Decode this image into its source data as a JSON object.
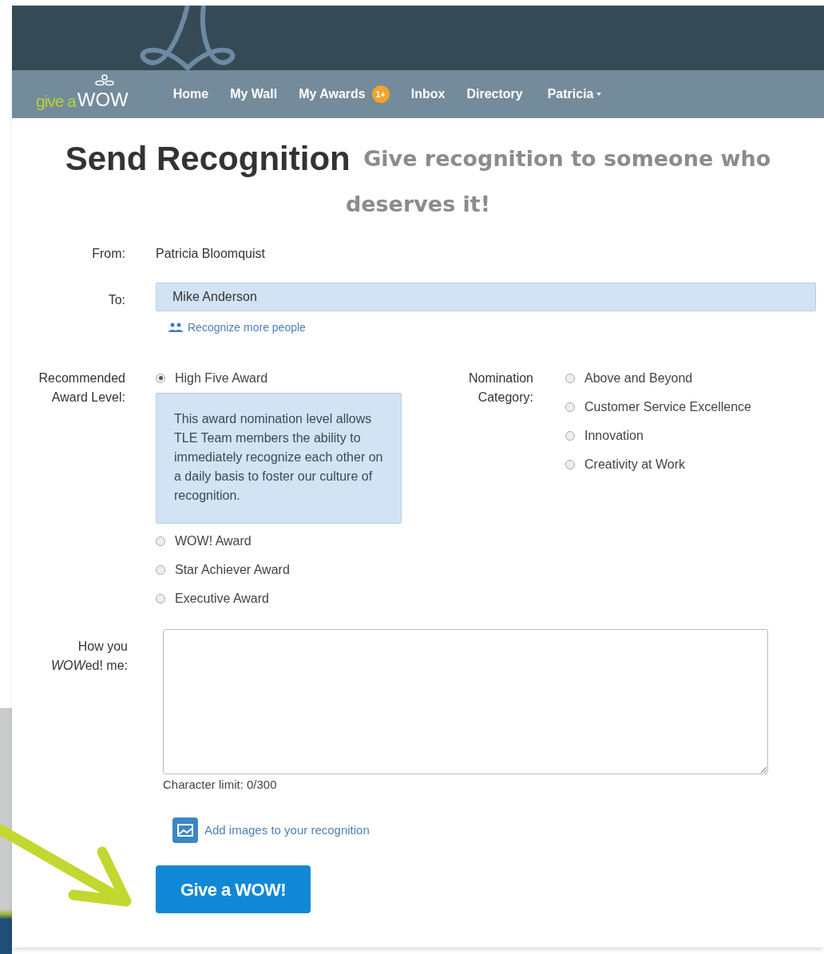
{
  "brand": {
    "first": "give a",
    "second": "WOW"
  },
  "nav": [
    {
      "label": "Home"
    },
    {
      "label": "My Wall"
    },
    {
      "label": "My Awards",
      "badge": "1+"
    },
    {
      "label": "Inbox"
    },
    {
      "label": "Directory"
    },
    {
      "label": "Patricia",
      "kind": "dropdown"
    }
  ],
  "heading": {
    "title": "Send Recognition",
    "subtitle": "Give recognition to someone who deserves it!"
  },
  "from": {
    "label": "From:",
    "value": "Patricia Bloomquist"
  },
  "to": {
    "label": "To:",
    "value": "Mike Anderson",
    "link": "Recognize more people"
  },
  "award_level": {
    "label": "Recommended Award Level:",
    "options": [
      {
        "label": "High Five Award",
        "selected": true,
        "description": "This award nomination level allows TLE Team members the ability to immediately recognize each other on a daily basis to foster our culture of recognition."
      },
      {
        "label": "WOW! Award",
        "selected": false
      },
      {
        "label": "Star Achiever Award",
        "selected": false
      },
      {
        "label": "Executive Award",
        "selected": false
      }
    ]
  },
  "nomination_category": {
    "label": "Nomination Category:",
    "options": [
      {
        "label": "Above and Beyond",
        "selected": false
      },
      {
        "label": "Customer Service Excellence",
        "selected": false
      },
      {
        "label": "Innovation",
        "selected": false
      },
      {
        "label": "Creativity at Work",
        "selected": false
      }
    ]
  },
  "message": {
    "label_parts": [
      {
        "text": "How you ",
        "italic": false
      },
      {
        "text": "WOW",
        "italic": true
      },
      {
        "text": "ed! me:",
        "italic": false
      }
    ],
    "counter": "Character limit: 0/300"
  },
  "add_images": "Add images to your recognition",
  "submit": "Give a WOW!"
}
